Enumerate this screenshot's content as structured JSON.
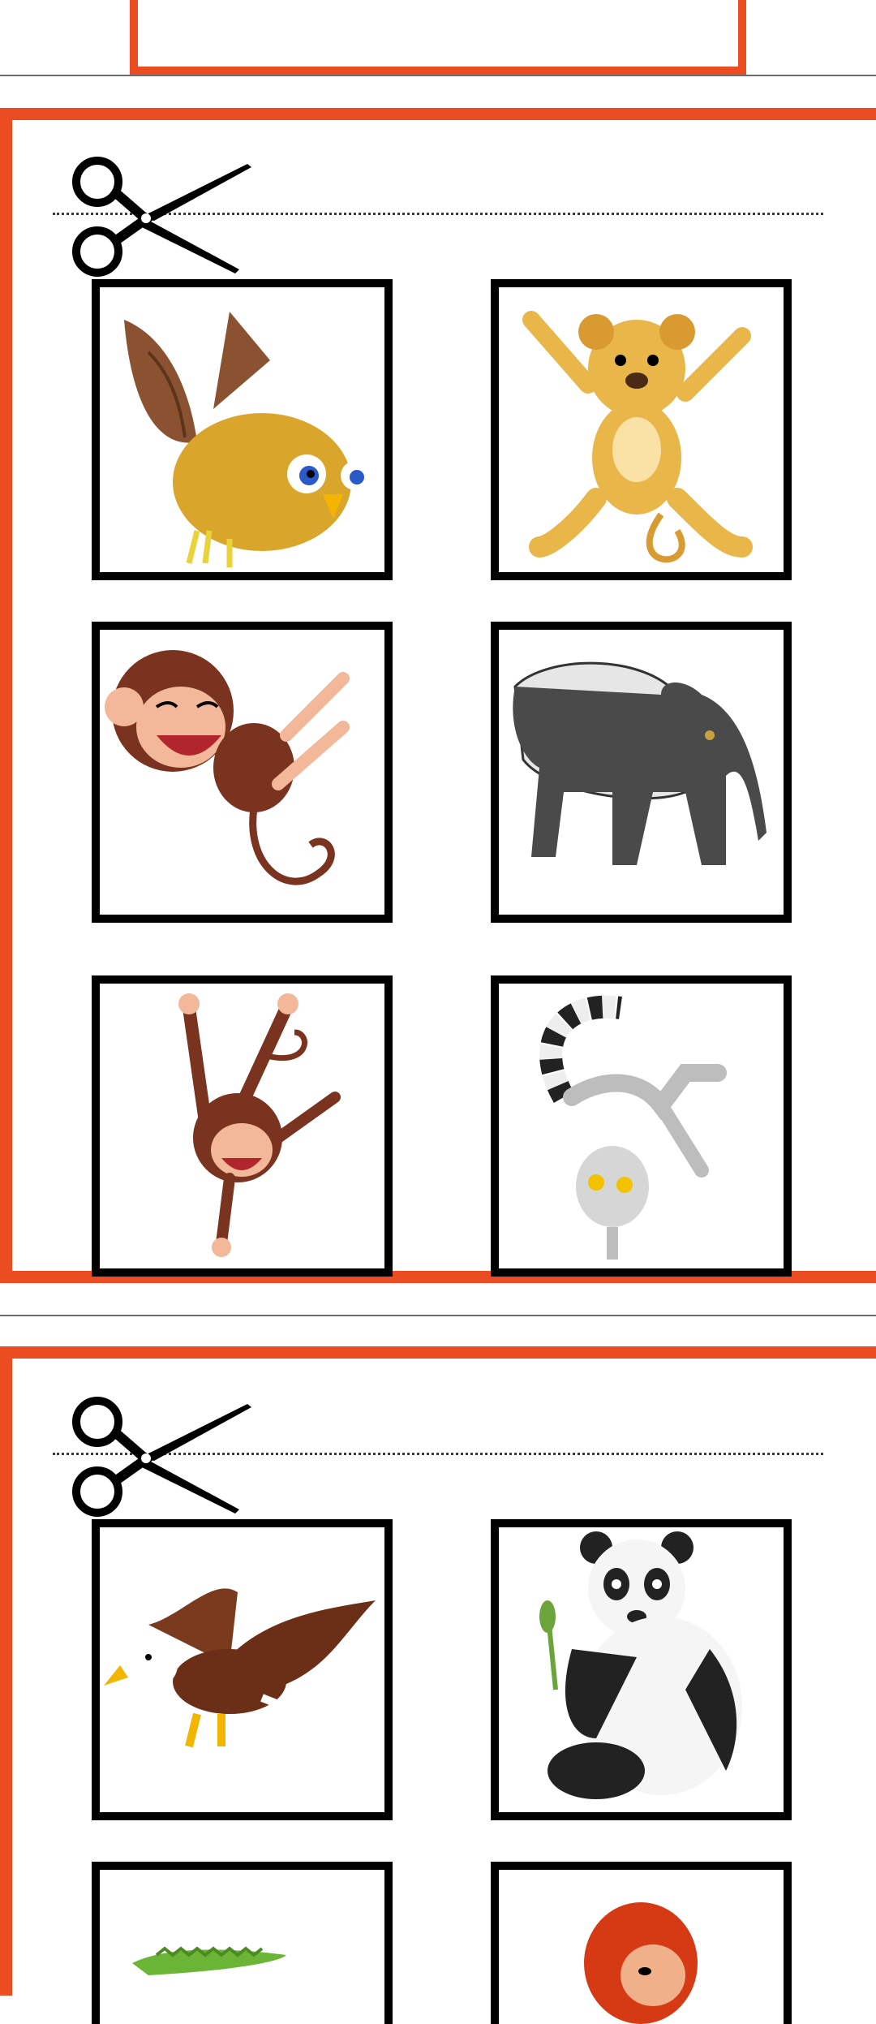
{
  "page": {
    "accent": "#ec4c22",
    "card_border": "#000000"
  },
  "sheets": [
    {
      "id": "sheet-2",
      "cut_icon": "scissors-icon",
      "cards": [
        {
          "name": "owl",
          "icon": "owl-illustration"
        },
        {
          "name": "lion-cub",
          "icon": "lion-cub-illustration"
        },
        {
          "name": "monkey-laughing",
          "icon": "monkey-laughing-illustration"
        },
        {
          "name": "tapir",
          "icon": "tapir-illustration"
        },
        {
          "name": "monkey-handstand",
          "icon": "monkey-handstand-illustration"
        },
        {
          "name": "lemur",
          "icon": "lemur-illustration"
        }
      ]
    },
    {
      "id": "sheet-3",
      "cut_icon": "scissors-icon",
      "cards": [
        {
          "name": "eagle",
          "icon": "eagle-illustration"
        },
        {
          "name": "panda",
          "icon": "panda-illustration"
        },
        {
          "name": "crocodile",
          "icon": "crocodile-illustration"
        },
        {
          "name": "orangutan",
          "icon": "orangutan-illustration"
        }
      ]
    }
  ]
}
